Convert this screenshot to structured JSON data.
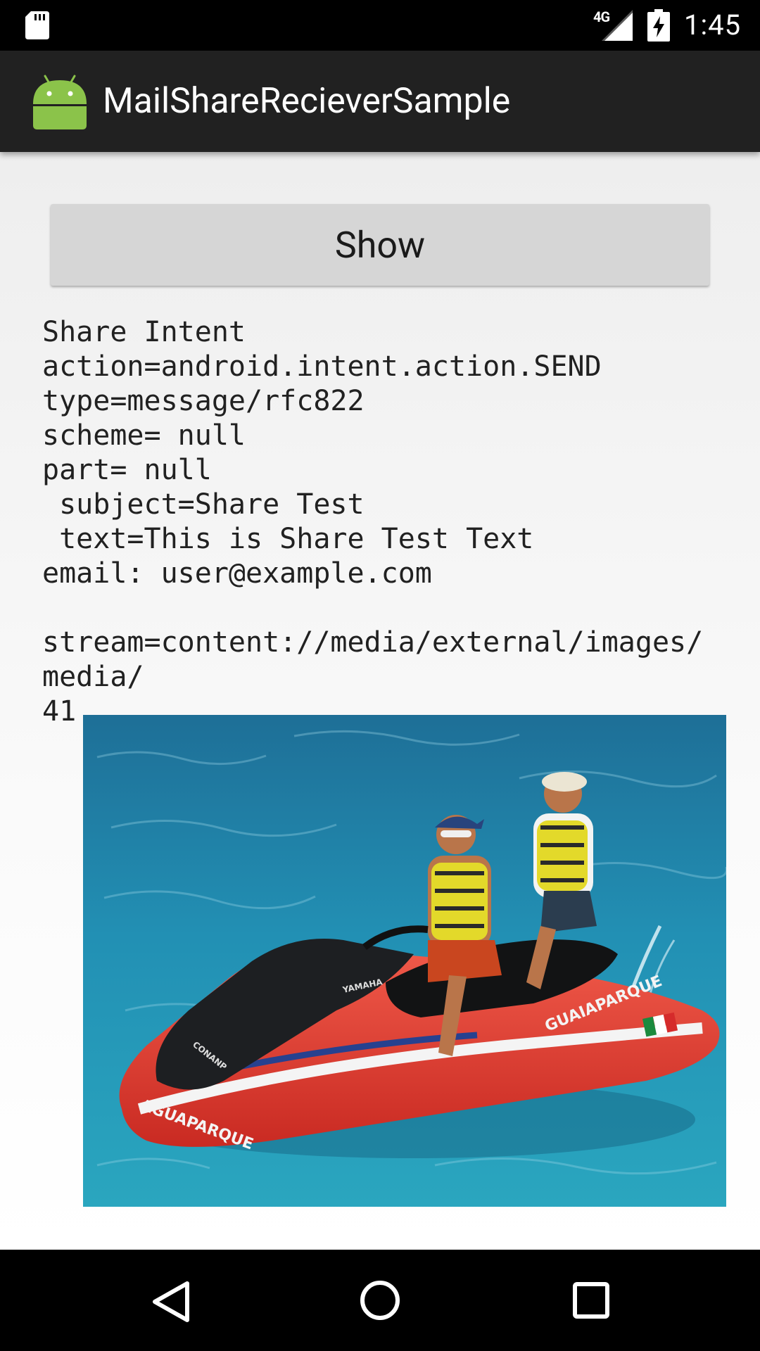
{
  "status_bar": {
    "network_label": "4G",
    "time": "1:45",
    "icons": [
      "sd-card-icon",
      "signal-icon",
      "battery-charging-icon"
    ]
  },
  "action_bar": {
    "icon": "android-robot-icon",
    "title": "MailShareRecieverSample"
  },
  "content": {
    "show_button_label": "Show",
    "intent_info": "Share Intent\naction=android.intent.action.SEND\ntype=message/rfc822\nscheme= null\npart= null\n subject=Share Test\n text=This is Share Test Text\nemail: user@example.com\n\nstream=content://media/external/images/media/\n41",
    "shared_image": {
      "description": "Two men riding a red jet ski on blue water",
      "hull_lettering": [
        "GUAIAPARQUE",
        "AGUAPARQUE",
        "YAMAHA",
        "CONANP"
      ]
    }
  },
  "nav_bar": {
    "buttons": [
      "back-icon",
      "home-icon",
      "recent-apps-icon"
    ]
  },
  "colors": {
    "status_bar": "#000000",
    "action_bar": "#212121",
    "content_bg": "#eeeeee",
    "button_bg": "#d6d6d6",
    "text": "#212121",
    "android_green": "#8bc34a"
  }
}
